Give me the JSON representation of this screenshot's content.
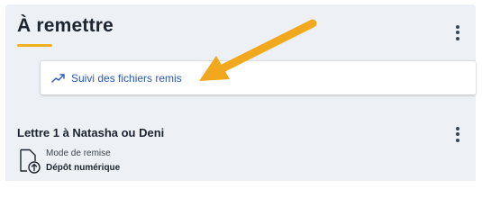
{
  "section": {
    "title": "À remettre",
    "accent_color": "#f2b21d"
  },
  "menu": {
    "items": [
      {
        "label": "Suivi des fichiers remis",
        "icon": "trend-line-icon"
      }
    ]
  },
  "assignment": {
    "title": "Lettre 1 à Natasha ou Deni",
    "delivery_mode_label": "Mode de remise",
    "delivery_mode_value": "Dépôt numérique",
    "icon": "file-upload-icon"
  },
  "annotation": {
    "arrow_color": "#f2a81d"
  }
}
